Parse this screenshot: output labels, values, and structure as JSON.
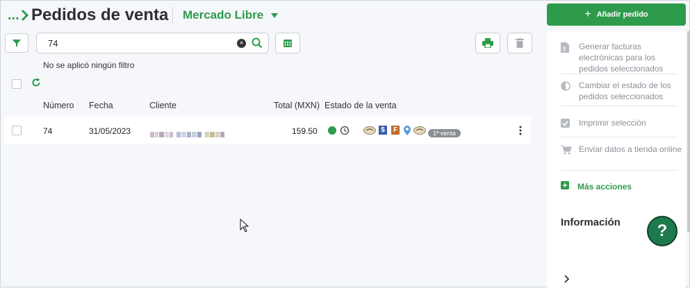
{
  "header": {
    "breadcrumb_dots": "...",
    "title": "Pedidos de venta",
    "channel": "Mercado Libre",
    "add_order_label": "Añadir pedido"
  },
  "toolbar": {
    "search_value": "74",
    "filter_note": "No se aplicó ningún filtro"
  },
  "table": {
    "columns": [
      "Número",
      "Fecha",
      "Cliente",
      "Total (MXN)",
      "Estado de la venta"
    ],
    "rows": [
      {
        "numero": "74",
        "fecha": "31/05/2023",
        "total": "159.50",
        "badge": "1ª venta"
      }
    ]
  },
  "panel": {
    "actions": [
      {
        "label": "Generar facturas electrónicas para los pedidos seleccionados",
        "icon": "invoice-icon"
      },
      {
        "label": "Cambiar el estado de los pedidos seleccionados",
        "icon": "half-circle-icon"
      },
      {
        "label": "Imprimir selección",
        "icon": "checkbox-icon"
      },
      {
        "label": "Enviar datos a tienda online",
        "icon": "cart-icon"
      }
    ],
    "more_actions": "Más acciones",
    "info_title": "Información",
    "help_label": "?"
  },
  "colors": {
    "accent": "#2e9b4b",
    "help": "#1e7a4c",
    "status_dot": "#2e9b4b"
  }
}
